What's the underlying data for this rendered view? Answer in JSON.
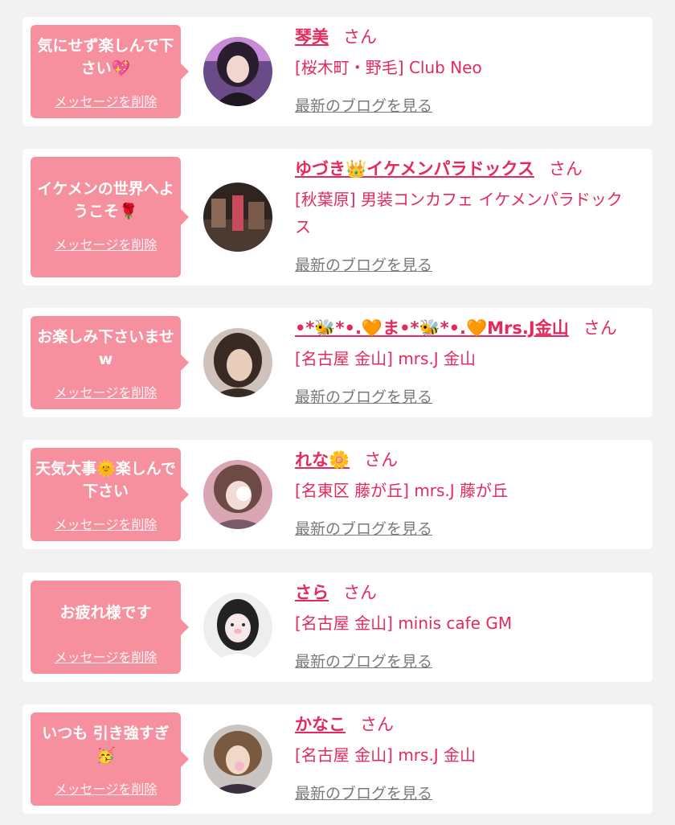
{
  "colors": {
    "accent": "#e5295c",
    "bubble": "#f7909e",
    "background": "#f2f2f2",
    "card": "#ffffff",
    "link_gray": "#7a7a7a"
  },
  "labels": {
    "delete": "メッセージを削除",
    "blog": "最新のブログを見る",
    "honorific": "さん"
  },
  "items": [
    {
      "message": "気にせず楽しんで下さい💖",
      "name": "琴美",
      "shop": "[桜木町・野毛] Club Neo",
      "avatar_icon": "portrait-photo"
    },
    {
      "message": "イケメンの世界へようこそ🌹",
      "name": "ゆづき👑イケメンパラドックス",
      "shop": "[秋葉原] 男装コンカフェ イケメンパラドックス",
      "avatar_icon": "group-photo"
    },
    {
      "message": "お楽しみ下さいませw",
      "name": "•*🐝*•.🧡ま•*🐝*•.🧡Mrs.J金山",
      "shop": "[名古屋 金山] mrs.J 金山",
      "avatar_icon": "portrait-photo"
    },
    {
      "message": "天気大事🌞楽しんで下さい",
      "name": "れな🌼",
      "shop": "[名東区 藤が丘] mrs.J 藤が丘",
      "avatar_icon": "portrait-photo"
    },
    {
      "message": "お疲れ様です",
      "name": "さら",
      "shop": "[名古屋 金山] minis cafe GM",
      "avatar_icon": "portrait-photo"
    },
    {
      "message": "いつも 引き強すぎ🥳",
      "name": "かなこ",
      "shop": "[名古屋 金山] mrs.J 金山",
      "avatar_icon": "portrait-photo"
    }
  ]
}
